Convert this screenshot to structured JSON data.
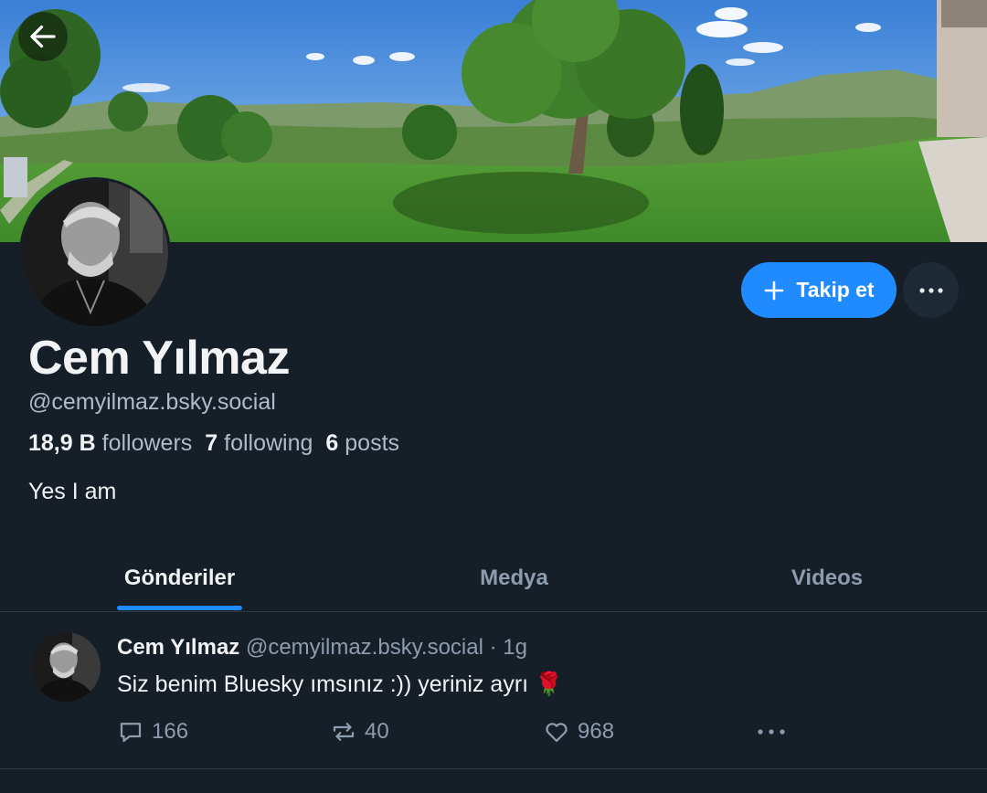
{
  "profile": {
    "display_name": "Cem Yılmaz",
    "handle": "@cemyilmaz.bsky.social",
    "bio": "Yes I am",
    "followers_count": "18,9 B",
    "followers_label": "followers",
    "following_count": "7",
    "following_label": "following",
    "posts_count": "6",
    "posts_label": "posts"
  },
  "actions": {
    "follow_label": "Takip et"
  },
  "tabs": [
    {
      "label": "Gönderiler",
      "active": true
    },
    {
      "label": "Medya",
      "active": false
    },
    {
      "label": "Videos",
      "active": false
    }
  ],
  "post": {
    "author": "Cem Yılmaz",
    "meta": "@cemyilmaz.bsky.social · 1g",
    "text": "Siz benim Bluesky ımsınız :)) yeriniz ayrı 🌹",
    "replies": "166",
    "reposts": "40",
    "likes": "968"
  },
  "colors": {
    "background": "#161e27",
    "accent": "#208bfe",
    "muted_text": "#8d9cae"
  },
  "icons": [
    "back-arrow-icon",
    "plus-icon",
    "more-icon",
    "reply-icon",
    "repost-icon",
    "like-icon"
  ]
}
